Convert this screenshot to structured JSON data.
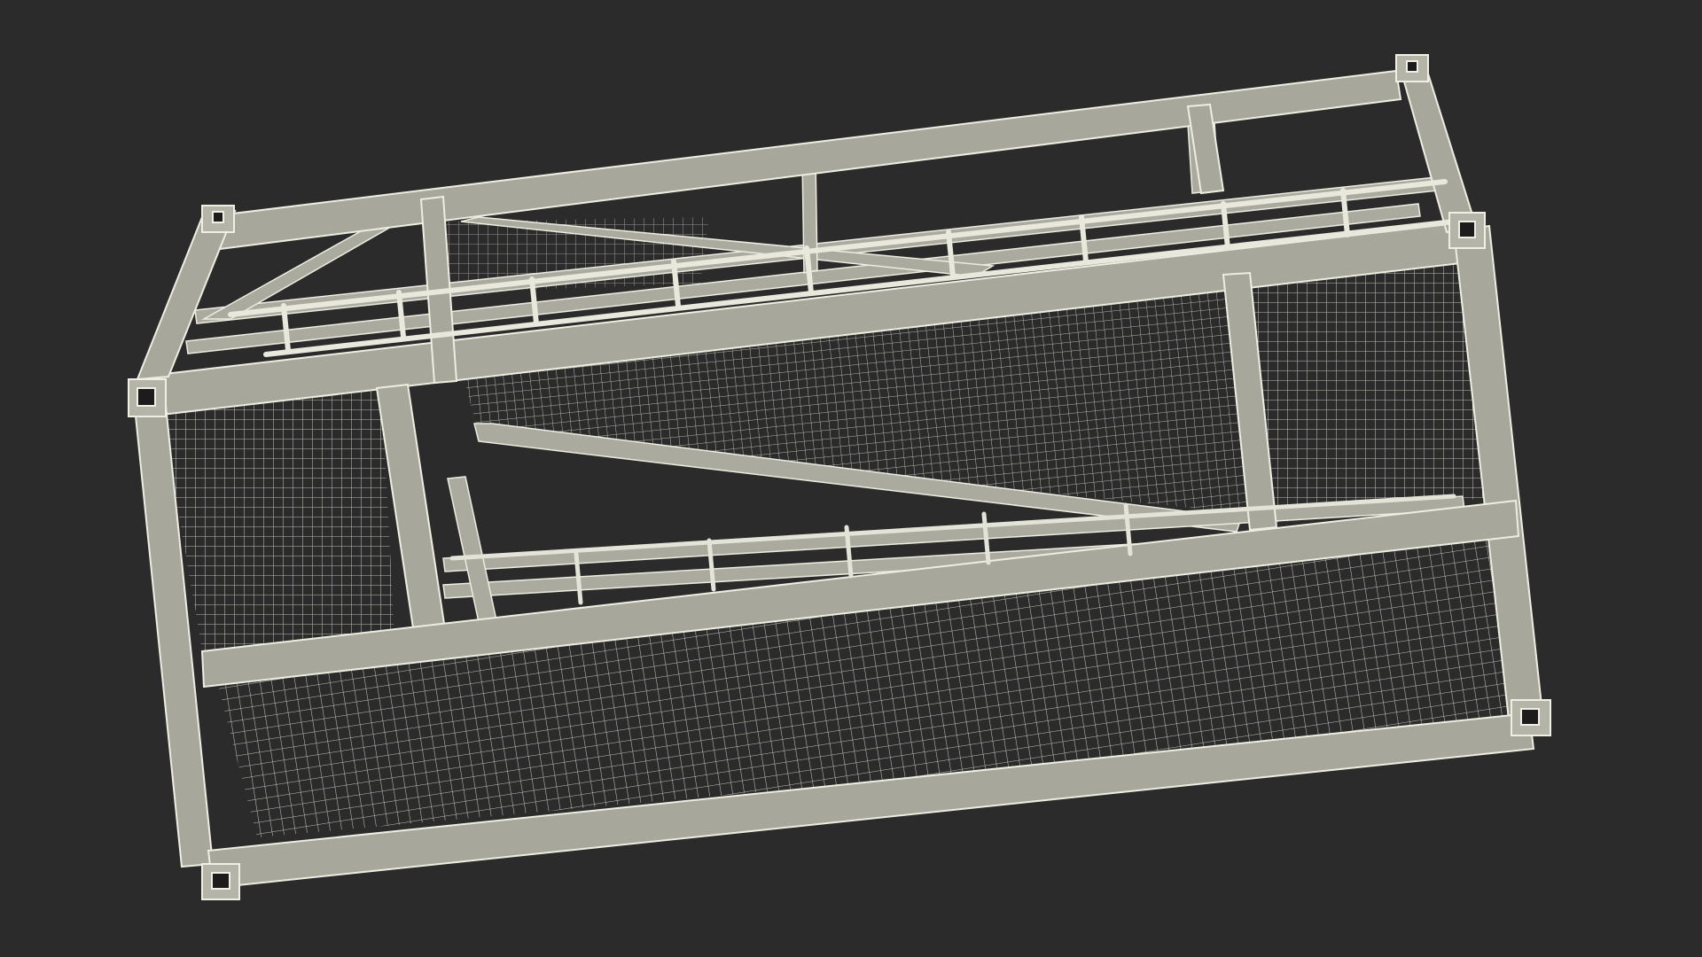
{
  "scene": {
    "background_color": "#2b2b2b",
    "frame_color": "#a9a99d",
    "frame_edge_color": "#e8e8dc",
    "mesh_color": "#d6d6cb",
    "corner_color": "#1c1c1c"
  }
}
